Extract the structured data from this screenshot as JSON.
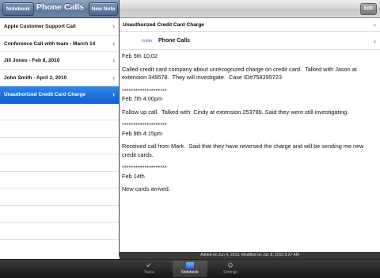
{
  "left_toolbar": {
    "notebook_button": "Notebook",
    "title": "Phone Calls",
    "new_note_button": "New Note"
  },
  "right_toolbar": {
    "edit_button": "Edit"
  },
  "notes_list": [
    {
      "title": "Apple Customer Support Call",
      "selected": false
    },
    {
      "title": "Conference Call with team - March 14",
      "selected": false
    },
    {
      "title": "Jill Jones - Feb 8, 2010",
      "selected": false
    },
    {
      "title": "John Smith - April 2, 2010",
      "selected": false
    },
    {
      "title": "Unauthorized Credit Card Charge",
      "selected": true
    }
  ],
  "detail": {
    "subject": "Unauthorized Credit Card Charge",
    "folder_label": "folder",
    "folder_value": "Phone Calls",
    "body": [
      "Feb 5th 10:02",
      "Called credit card company about unrecognized charge on credit card.  Talked with Jason at extension 349578.  They will investigate.  Case ID#758395723",
      "********************\nFeb 7th 4:00pm",
      "Follow up call.  Talked with  Cindy at extension 253789. Said they were still investigating.",
      "********************\nFeb 9th 4:15pm",
      "Received call from Mark.  Said that they have reversed the charge and will be sending me new credit cards.",
      "********************\nFeb 14th",
      "New cards arrived."
    ],
    "info": "Added on Jun 4, 2010.   Modified on Jun 8, 2010 9:27 AM"
  },
  "tabbar": {
    "tabs": [
      {
        "label": "Tasks",
        "icon": "checkmark-icon",
        "active": false
      },
      {
        "label": "Notebook",
        "icon": "notebook-icon",
        "active": true
      },
      {
        "label": "Settings",
        "icon": "gear-icon",
        "active": false
      }
    ]
  },
  "colors": {
    "selection": "#1a6fe0",
    "toolbar_blue": "#6b84a6",
    "folder_label": "#3d6bb8"
  }
}
